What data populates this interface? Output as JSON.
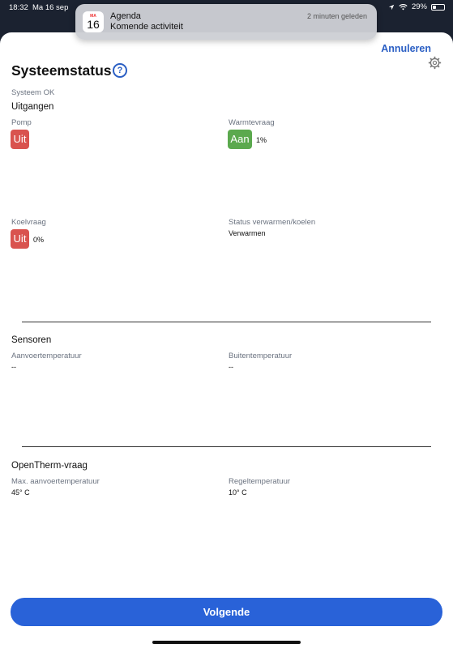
{
  "status_bar": {
    "time": "18:32",
    "date": "Ma 16 sep",
    "battery": "29%",
    "battery_level": 0.29
  },
  "notification": {
    "app": "Agenda",
    "message": "Komende activiteit",
    "time_ago": "2 minuten geleden",
    "icon_month": "MA",
    "icon_day": "16"
  },
  "header": {
    "cancel": "Annuleren",
    "title": "Systeemstatus",
    "help_glyph": "?"
  },
  "system_state": "Systeem OK",
  "outputs": {
    "heading": "Uitgangen",
    "pump": {
      "label": "Pomp",
      "state": "Uit"
    },
    "heat_demand": {
      "label": "Warmtevraag",
      "state": "Aan",
      "value": "1%"
    },
    "cool_demand": {
      "label": "Koelvraag",
      "state": "Uit",
      "value": "0%"
    },
    "mode": {
      "label": "Status verwarmen/koelen",
      "value": "Verwarmen"
    }
  },
  "sensors": {
    "heading": "Sensoren",
    "supply_temp": {
      "label": "Aanvoertemperatuur",
      "value": "--"
    },
    "outside_temp": {
      "label": "Buitentemperatuur",
      "value": "--"
    }
  },
  "opentherm": {
    "heading": "OpenTherm-vraag",
    "max_supply": {
      "label": "Max. aanvoertemperatuur",
      "value": "45° C"
    },
    "control_temp": {
      "label": "Regeltemperatuur",
      "value": "10° C"
    }
  },
  "footer": {
    "next": "Volgende"
  },
  "colors": {
    "accent": "#2962d8",
    "off": "#d9534f",
    "on": "#5ba94e"
  },
  "icons": [
    "navigation-icon",
    "wifi-icon",
    "battery-icon",
    "calendar-icon",
    "help-icon",
    "gear-icon"
  ]
}
